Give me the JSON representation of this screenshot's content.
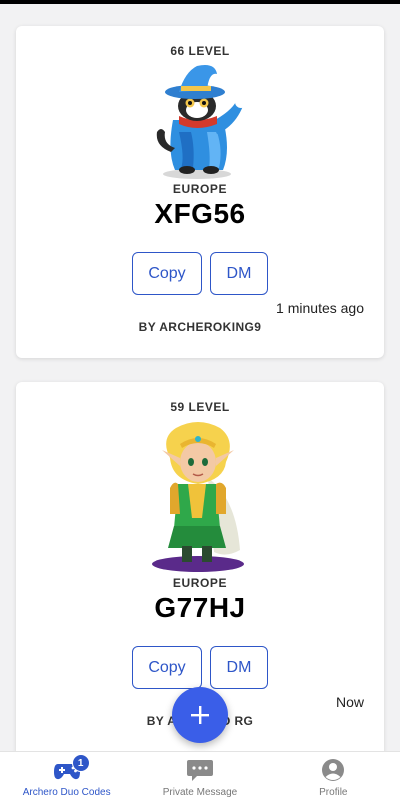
{
  "colors": {
    "accent": "#2e56c8",
    "fab": "#3a5ee8",
    "background": "#f2f2f3"
  },
  "cards": [
    {
      "level": "66 LEVEL",
      "hero": "wizard-cat",
      "region": "EUROPE",
      "code": "XFG56",
      "copy_label": "Copy",
      "dm_label": "DM",
      "time": "1 minutes ago",
      "by": "BY ARCHEROKING9"
    },
    {
      "level": "59 LEVEL",
      "hero": "elf-princess",
      "region": "EUROPE",
      "code": "G77HJ",
      "copy_label": "Copy",
      "dm_label": "DM",
      "time": "Now",
      "by": "BY ARCHERO RG"
    }
  ],
  "fab": {
    "icon": "plus-icon"
  },
  "nav": {
    "items": [
      {
        "label": "Archero Duo Codes",
        "icon": "gamepad-icon",
        "badge": "1",
        "active": true
      },
      {
        "label": "Private Message",
        "icon": "chat-icon",
        "active": false
      },
      {
        "label": "Profile",
        "icon": "profile-icon",
        "active": false
      }
    ]
  }
}
